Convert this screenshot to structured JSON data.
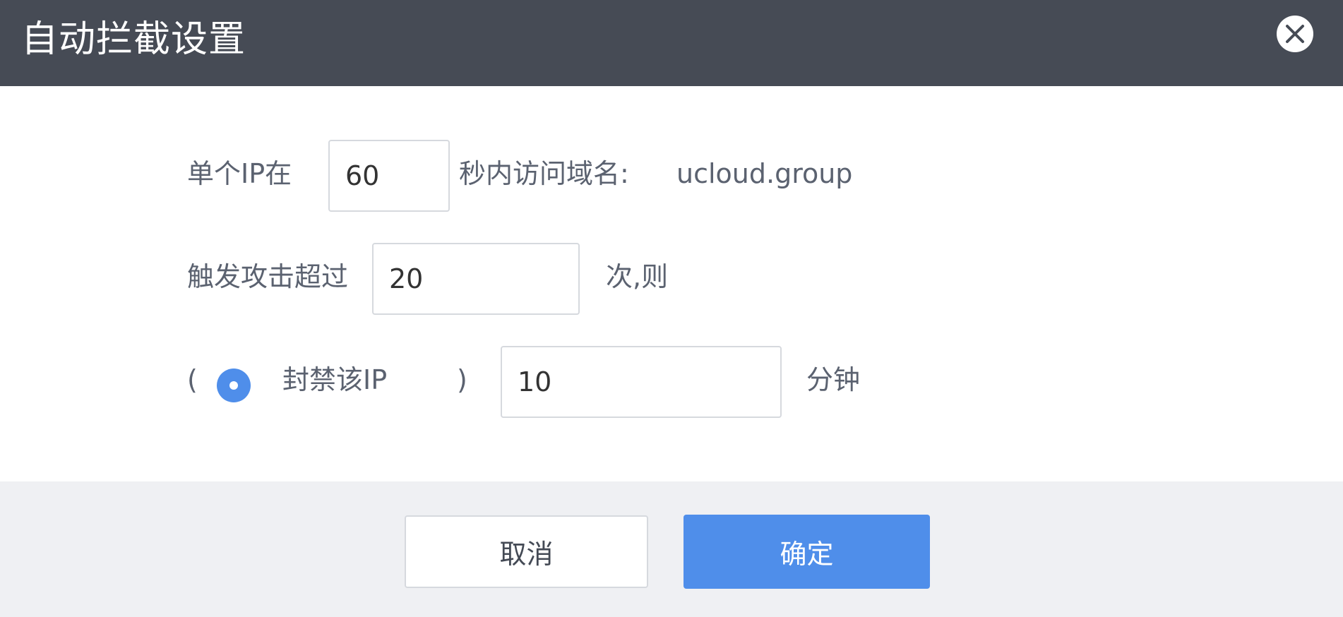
{
  "dialog": {
    "title": "自动拦截设置",
    "close_icon": "close-circle-icon"
  },
  "form": {
    "row1": {
      "prefix": "单个IP在",
      "seconds_value": "60",
      "suffix": "秒内访问域名:",
      "domain": "ucloud.group"
    },
    "row2": {
      "prefix": "触发攻击超过",
      "count_value": "20",
      "suffix": "次,则"
    },
    "row3": {
      "open_paren": "(",
      "radio_label": "封禁该IP",
      "radio_selected": true,
      "close_paren": ")",
      "minutes_value": "10",
      "suffix": "分钟"
    }
  },
  "footer": {
    "cancel_label": "取消",
    "confirm_label": "确定"
  },
  "colors": {
    "header_bg": "#464b55",
    "accent": "#4f8eea",
    "footer_bg": "#eff0f3",
    "label_text": "#5b6270"
  }
}
